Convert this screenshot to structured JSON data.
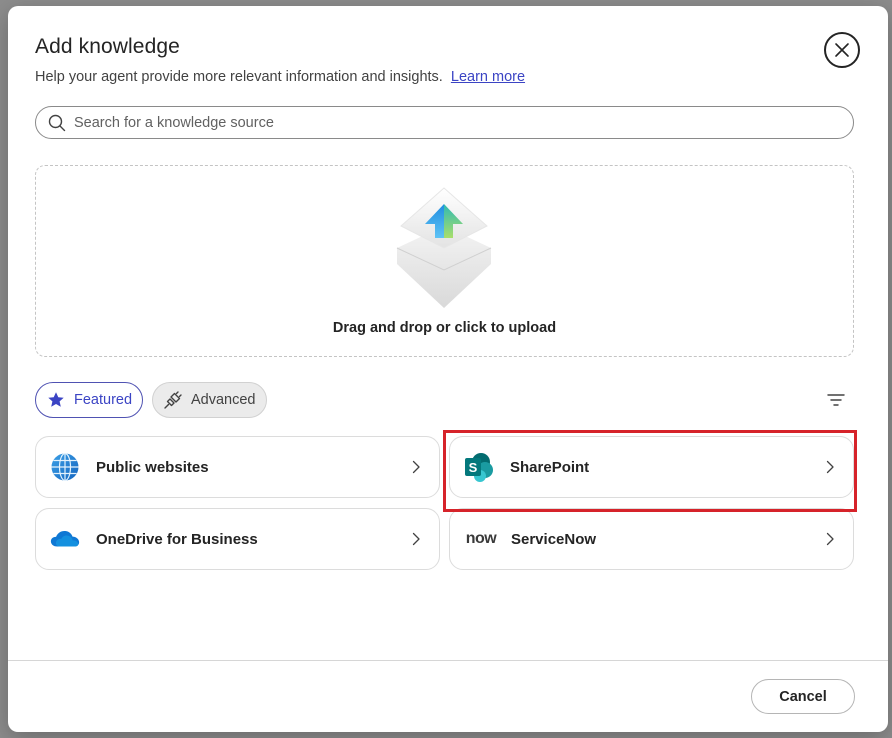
{
  "dialog": {
    "title": "Add knowledge",
    "subtitle": "Help your agent provide more relevant information and insights.",
    "learn_more": "Learn more"
  },
  "search": {
    "placeholder": "Search for a knowledge source",
    "value": ""
  },
  "upload": {
    "label": "Drag and drop or click to upload"
  },
  "filters": {
    "featured_label": "Featured",
    "advanced_label": "Advanced",
    "active": "Featured"
  },
  "sources": [
    {
      "label": "Public websites",
      "icon": "globe-icon"
    },
    {
      "label": "SharePoint",
      "icon": "sharepoint-icon",
      "highlighted": true
    },
    {
      "label": "OneDrive for Business",
      "icon": "onedrive-icon"
    },
    {
      "label": "ServiceNow",
      "icon": "servicenow-icon",
      "icon_text": "now"
    }
  ],
  "footer": {
    "cancel_label": "Cancel"
  },
  "colors": {
    "accent": "#4f52b2",
    "highlight": "#d6232a"
  }
}
